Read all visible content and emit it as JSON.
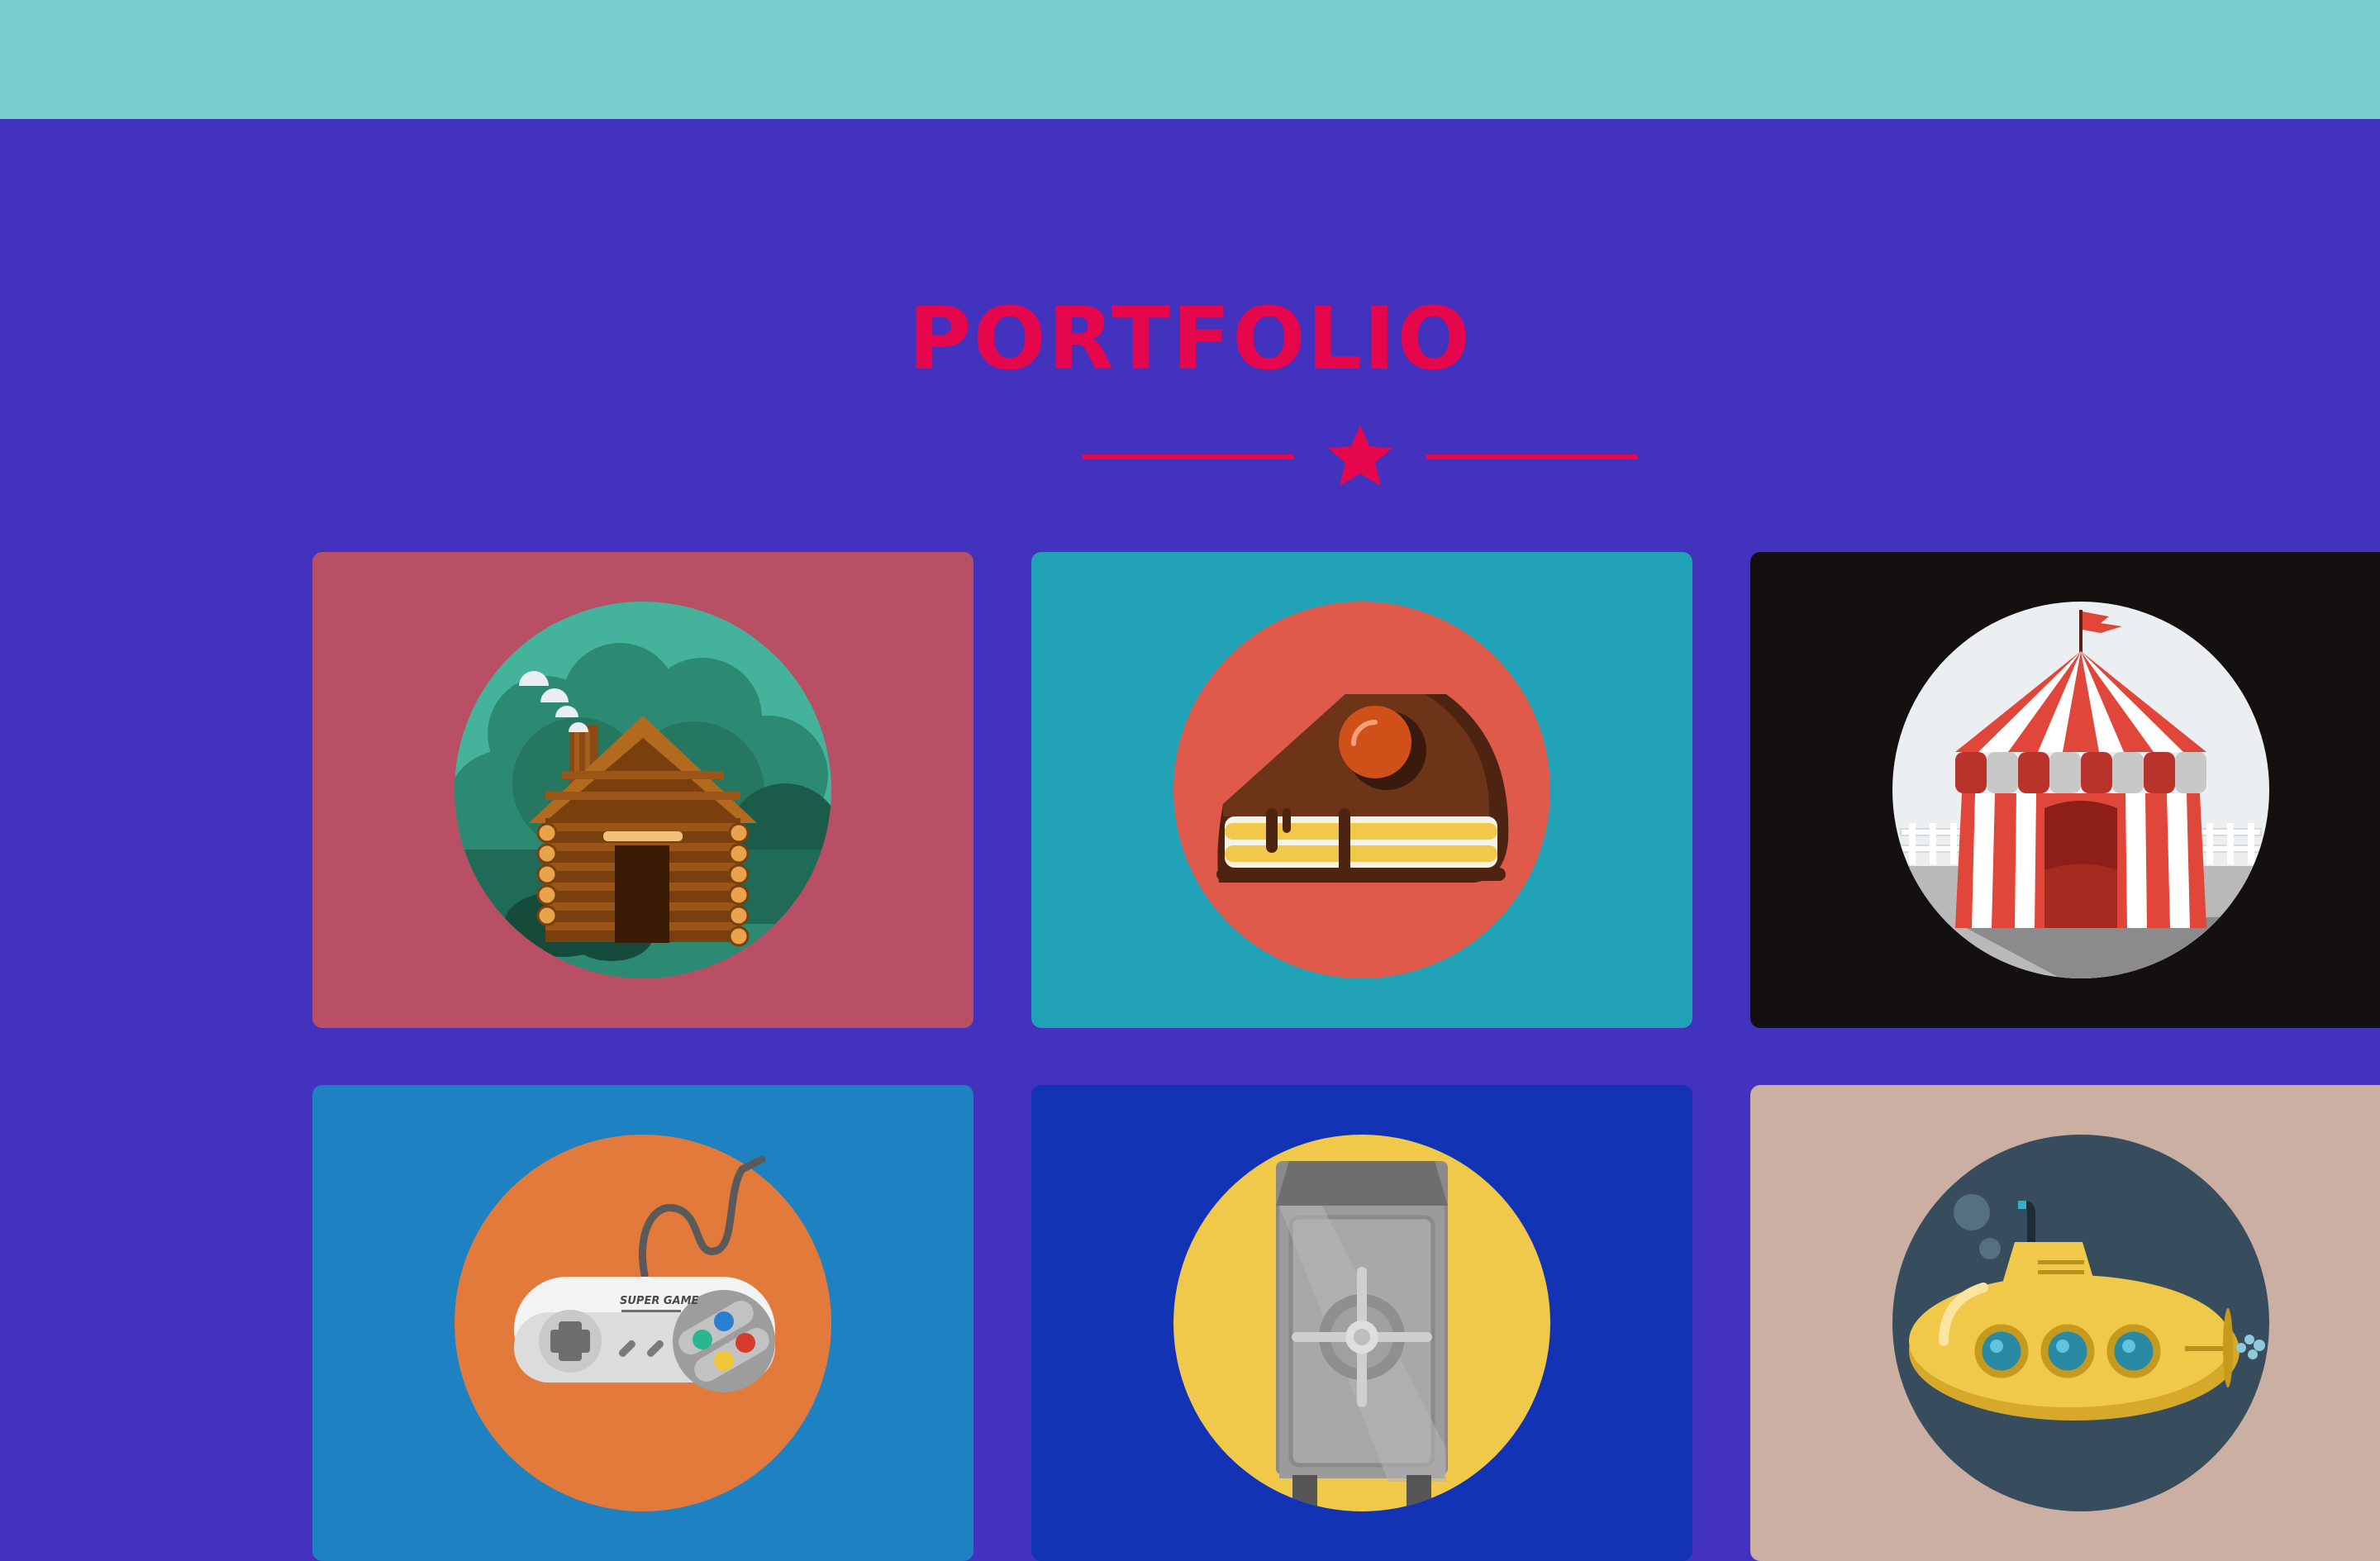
{
  "page": {
    "title": "PORTFOLIO",
    "colors": {
      "topbar": "#79cdd0",
      "background": "#4232bd",
      "accent": "#e5064c"
    }
  },
  "portfolio": {
    "items": [
      {
        "icon": "log-cabin-icon",
        "color": "#b94f64"
      },
      {
        "icon": "cake-slice-icon",
        "color": "#22a2b6"
      },
      {
        "icon": "circus-tent-icon",
        "color": "#141010"
      },
      {
        "icon": "game-controller-icon",
        "color": "#1e82c2",
        "text": "SUPER GAME"
      },
      {
        "icon": "safe-icon",
        "color": "#1133b4"
      },
      {
        "icon": "submarine-icon",
        "color": "#cbafa2"
      }
    ]
  }
}
